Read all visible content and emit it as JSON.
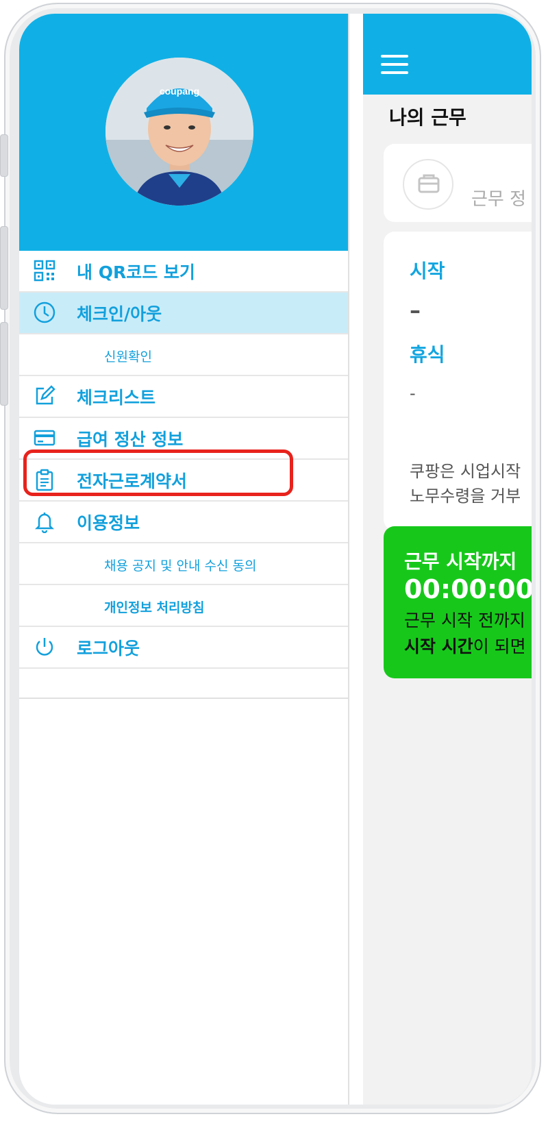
{
  "drawer": {
    "menu": [
      {
        "label": "내 QR코드 보기",
        "icon": "qr-code-icon"
      },
      {
        "label": "체크인/아웃",
        "icon": "clock-icon",
        "active": true
      },
      {
        "label": "신원확인",
        "sub": true
      },
      {
        "label": "체크리스트",
        "icon": "edit-icon"
      },
      {
        "label": "급여 정산 정보",
        "icon": "credit-card-icon"
      },
      {
        "label": "전자근로계약서",
        "icon": "clipboard-icon",
        "highlighted": true
      },
      {
        "label": "이용정보",
        "icon": "bell-icon"
      },
      {
        "label": "채용 공지 및 안내 수신 동의",
        "sub": true
      },
      {
        "label": "개인정보 처리방침",
        "sub": true
      },
      {
        "label": "로그아웃",
        "icon": "power-icon"
      }
    ],
    "avatar_cap_text": "coupang"
  },
  "main": {
    "title": "나의 근무",
    "status_text": "근무 정",
    "start_label": "시작",
    "start_value": "–",
    "break_label": "휴식",
    "break_value": "-",
    "notice_line1": "쿠팡은 시업시작",
    "notice_line2": "노무수령을 거부",
    "countdown_title": "근무 시작까지",
    "countdown_time": "00:00:00",
    "countdown_line1": "근무 시작 전까지",
    "countdown_line2_bold": "시작 시간",
    "countdown_line2_rest": "이 되면"
  },
  "colors": {
    "brand_blue": "#10b0e6",
    "menu_text": "#12a0dc",
    "active_bg": "#c9ecf9",
    "green": "#17c81b",
    "highlight_red": "#e8221c"
  }
}
